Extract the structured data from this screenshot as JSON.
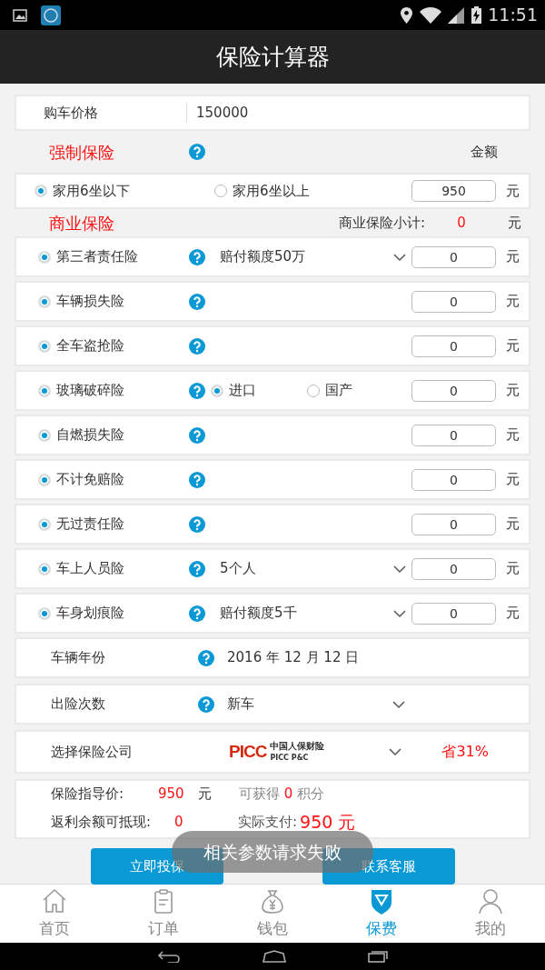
{
  "status_bar": {
    "time": "11:51"
  },
  "title": "保险计算器",
  "price": {
    "label": "购车价格",
    "value": "150000"
  },
  "compulsory": {
    "title": "强制保险",
    "amount_header": "金额",
    "options": [
      {
        "label": "家用6坐以下",
        "selected": true
      },
      {
        "label": "家用6坐以上",
        "selected": false
      }
    ],
    "amount": "950",
    "unit": "元"
  },
  "commercial": {
    "title": "商业保险",
    "subtotal_label": "商业保险小计:",
    "subtotal": "0",
    "unit": "元",
    "items": [
      {
        "kind": "dropdown",
        "name": "第三者责任险",
        "checked": true,
        "option": "赔付额度50万",
        "amount": "0",
        "unit": "元"
      },
      {
        "kind": "plain",
        "name": "车辆损失险",
        "checked": true,
        "amount": "0",
        "unit": "元"
      },
      {
        "kind": "plain",
        "name": "全车盗抢险",
        "checked": true,
        "amount": "0",
        "unit": "元"
      },
      {
        "kind": "radio",
        "name": "玻璃破碎险",
        "checked": true,
        "choices": [
          {
            "label": "进口",
            "selected": true
          },
          {
            "label": "国产",
            "selected": false
          }
        ],
        "amount": "0",
        "unit": "元"
      },
      {
        "kind": "plain",
        "name": "自燃损失险",
        "checked": true,
        "amount": "0",
        "unit": "元"
      },
      {
        "kind": "plain",
        "name": "不计免赔险",
        "checked": true,
        "amount": "0",
        "unit": "元"
      },
      {
        "kind": "plain",
        "name": "无过责任险",
        "checked": true,
        "amount": "0",
        "unit": "元"
      },
      {
        "kind": "dropdown",
        "name": "车上人员险",
        "checked": true,
        "option": "5个人",
        "amount": "0",
        "unit": "元"
      },
      {
        "kind": "dropdown",
        "name": "车身划痕险",
        "checked": true,
        "option": "赔付额度5千",
        "amount": "0",
        "unit": "元"
      }
    ]
  },
  "vehicle_year": {
    "label": "车辆年份",
    "value": "2016 年 12 月 12 日"
  },
  "claims": {
    "label": "出险次数",
    "value": "新车"
  },
  "company": {
    "label": "选择保险公司",
    "logo": {
      "mark": "PICC",
      "name_cn": "中国人保财险",
      "name_en": "PICC P&C"
    },
    "discount": "省31%"
  },
  "summary": {
    "guide_label": "保险指导价:",
    "guide_value": "950",
    "guide_unit": "元",
    "points_prefix": "可获得",
    "points": "0",
    "points_suffix": "积分",
    "rebate_label": "返利余额可抵现:",
    "rebate_value": "0",
    "pay_label": "实际支付:",
    "pay_value": "950 元"
  },
  "buttons": [
    "立即投保",
    "联系客服"
  ],
  "toast": "相关参数请求失败",
  "tabs": [
    {
      "kind": "home",
      "label": "首页",
      "selected": false
    },
    {
      "kind": "orders",
      "label": "订单",
      "selected": false
    },
    {
      "kind": "wallet",
      "label": "钱包",
      "selected": false
    },
    {
      "kind": "shield",
      "label": "保费",
      "selected": true
    },
    {
      "kind": "person",
      "label": "我的",
      "selected": false
    }
  ]
}
